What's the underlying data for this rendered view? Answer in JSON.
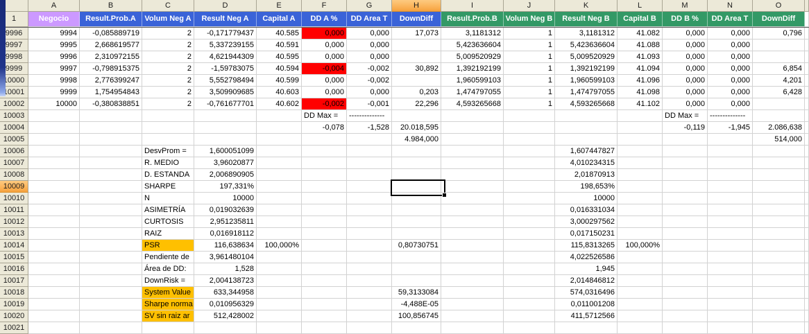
{
  "app": {
    "description": "spreadsheet-grid"
  },
  "selection": {
    "active_cell": "H10009",
    "column": "H",
    "row": "10009"
  },
  "colors": {
    "blue": "#3A63D8",
    "green": "#339966",
    "lav": "#CC99FF",
    "gold": "#FFC000",
    "red": "#FF0000",
    "grid": "#D2D2D2",
    "hdrbg": "#ECE9D8",
    "hdrbrd": "#A9A593",
    "selhl": "#FBB55C"
  },
  "grid": {
    "column_letters": [
      "A",
      "B",
      "C",
      "D",
      "E",
      "F",
      "G",
      "H",
      "I",
      "J",
      "K",
      "L",
      "M",
      "N",
      "O"
    ],
    "frozen_row_number": "1",
    "header_row": [
      {
        "col": "A",
        "label": "Negocio",
        "color": "lav"
      },
      {
        "col": "B",
        "label": "Result.Prob.A",
        "color": "blue"
      },
      {
        "col": "C",
        "label": "Volum Neg A",
        "color": "blue"
      },
      {
        "col": "D",
        "label": "Result Neg A",
        "color": "blue"
      },
      {
        "col": "E",
        "label": "Capital A",
        "color": "blue"
      },
      {
        "col": "F",
        "label": "DD A %",
        "color": "blue"
      },
      {
        "col": "G",
        "label": "DD Area T",
        "color": "blue"
      },
      {
        "col": "H",
        "label": "DownDiff",
        "color": "blue"
      },
      {
        "col": "I",
        "label": "Result.Prob.B",
        "color": "green"
      },
      {
        "col": "J",
        "label": "Volum Neg B",
        "color": "green"
      },
      {
        "col": "K",
        "label": "Result Neg B",
        "color": "green"
      },
      {
        "col": "L",
        "label": "Capital B",
        "color": "green"
      },
      {
        "col": "M",
        "label": "DD B %",
        "color": "green"
      },
      {
        "col": "N",
        "label": "DD Area T",
        "color": "green"
      },
      {
        "col": "O",
        "label": "DownDiff",
        "color": "green"
      }
    ],
    "red_cells": [
      "F9996",
      "F9999",
      "F10002"
    ],
    "gold_cells": [
      "C10014",
      "C10018",
      "C10019",
      "C10020"
    ],
    "left_aligned_cells": [
      "F10003",
      "G10003",
      "M10003",
      "N10003",
      "C10006",
      "C10007",
      "C10008",
      "C10009",
      "C10010",
      "C10011",
      "C10012",
      "C10013",
      "C10014",
      "C10015",
      "C10016",
      "C10017",
      "C10018",
      "C10019",
      "C10020"
    ],
    "rows": [
      {
        "n": 9996,
        "cells": {
          "A": "9994",
          "B": "-0,085889719",
          "C": "2",
          "D": "-0,171779437",
          "E": "40.585",
          "F": "0,000",
          "G": "0,000",
          "H": "17,073",
          "I": "3,1181312",
          "J": "1",
          "K": "3,1181312",
          "L": "41.082",
          "M": "0,000",
          "N": "0,000",
          "O": "0,796"
        }
      },
      {
        "n": 9997,
        "cells": {
          "A": "9995",
          "B": "2,668619577",
          "C": "2",
          "D": "5,337239155",
          "E": "40.591",
          "F": "0,000",
          "G": "0,000",
          "I": "5,423636604",
          "J": "1",
          "K": "5,423636604",
          "L": "41.088",
          "M": "0,000",
          "N": "0,000"
        }
      },
      {
        "n": 9998,
        "cells": {
          "A": "9996",
          "B": "2,310972155",
          "C": "2",
          "D": "4,621944309",
          "E": "40.595",
          "F": "0,000",
          "G": "0,000",
          "I": "5,009520929",
          "J": "1",
          "K": "5,009520929",
          "L": "41.093",
          "M": "0,000",
          "N": "0,000"
        }
      },
      {
        "n": 9999,
        "cells": {
          "A": "9997",
          "B": "-0,798915375",
          "C": "2",
          "D": "-1,59783075",
          "E": "40.594",
          "F": "-0,004",
          "G": "-0,002",
          "H": "30,892",
          "I": "1,392192199",
          "J": "1",
          "K": "1,392192199",
          "L": "41.094",
          "M": "0,000",
          "N": "0,000",
          "O": "6,854"
        }
      },
      {
        "n": 10000,
        "cells": {
          "A": "9998",
          "B": "2,776399247",
          "C": "2",
          "D": "5,552798494",
          "E": "40.599",
          "F": "0,000",
          "G": "-0,002",
          "I": "1,960599103",
          "J": "1",
          "K": "1,960599103",
          "L": "41.096",
          "M": "0,000",
          "N": "0,000",
          "O": "4,201"
        }
      },
      {
        "n": 10001,
        "cells": {
          "A": "9999",
          "B": "1,754954843",
          "C": "2",
          "D": "3,509909685",
          "E": "40.603",
          "F": "0,000",
          "G": "0,000",
          "H": "0,203",
          "I": "1,474797055",
          "J": "1",
          "K": "1,474797055",
          "L": "41.098",
          "M": "0,000",
          "N": "0,000",
          "O": "6,428"
        }
      },
      {
        "n": 10002,
        "cells": {
          "A": "10000",
          "B": "-0,380838851",
          "C": "2",
          "D": "-0,761677701",
          "E": "40.602",
          "F": "-0,002",
          "G": "-0,001",
          "H": "22,296",
          "I": "4,593265668",
          "J": "1",
          "K": "4,593265668",
          "L": "41.102",
          "M": "0,000",
          "N": "0,000"
        }
      },
      {
        "n": 10003,
        "cells": {
          "F": "DD Max =",
          "G": "--------------",
          "M": "DD Max =",
          "N": "--------------"
        }
      },
      {
        "n": 10004,
        "cells": {
          "F": "-0,078",
          "G": "-1,528",
          "H": "20.018,595",
          "M": "-0,119",
          "N": "-1,945",
          "O": "2.086,638"
        }
      },
      {
        "n": 10005,
        "cells": {
          "H": "4.984,000",
          "O": "514,000"
        }
      },
      {
        "n": 10006,
        "cells": {
          "C": "DesvProm =",
          "D": "1,600051099",
          "K": "1,607447827"
        }
      },
      {
        "n": 10007,
        "cells": {
          "C": "R. MEDIO",
          "D": "3,96020877",
          "K": "4,010234315"
        }
      },
      {
        "n": 10008,
        "cells": {
          "C": "D. ESTANDA",
          "D": "2,006890905",
          "K": "2,01870913"
        }
      },
      {
        "n": 10009,
        "cells": {
          "C": "SHARPE",
          "D": "197,331%",
          "K": "198,653%"
        }
      },
      {
        "n": 10010,
        "cells": {
          "C": "N",
          "D": "10000",
          "K": "10000"
        }
      },
      {
        "n": 10011,
        "cells": {
          "C": "ASIMETRÍA",
          "D": "0,019032639",
          "K": "0,016331034"
        }
      },
      {
        "n": 10012,
        "cells": {
          "C": "CURTOSIS",
          "D": "2,951235811",
          "K": "3,000297562"
        }
      },
      {
        "n": 10013,
        "cells": {
          "C": "RAIZ",
          "D": "0,016918112",
          "K": "0,017150231"
        }
      },
      {
        "n": 10014,
        "cells": {
          "C": "PSR",
          "D": "116,638634",
          "E": "100,000%",
          "H": "0,80730751",
          "K": "115,8313265",
          "L": "100,000%"
        }
      },
      {
        "n": 10015,
        "cells": {
          "C": "Pendiente de",
          "D": "3,961480104",
          "K": "4,022526586"
        }
      },
      {
        "n": 10016,
        "cells": {
          "C": "Área de DD:",
          "D": "1,528",
          "K": "1,945"
        }
      },
      {
        "n": 10017,
        "cells": {
          "C": "DownRisk  =",
          "D": "2,004138723",
          "K": "2,014846812"
        }
      },
      {
        "n": 10018,
        "cells": {
          "C": "System Value",
          "D": "633,344958",
          "H": "59,3133084",
          "K": "574,0316496"
        }
      },
      {
        "n": 10019,
        "cells": {
          "C": "Sharpe norma",
          "D": "0,010956329",
          "H": "-4,488E-05",
          "K": "0,011001208"
        }
      },
      {
        "n": 10020,
        "cells": {
          "C": "SV sin raiz ar",
          "D": "512,428002",
          "H": "100,856745",
          "K": "411,5712566"
        }
      },
      {
        "n": 10021,
        "cells": {}
      }
    ]
  }
}
